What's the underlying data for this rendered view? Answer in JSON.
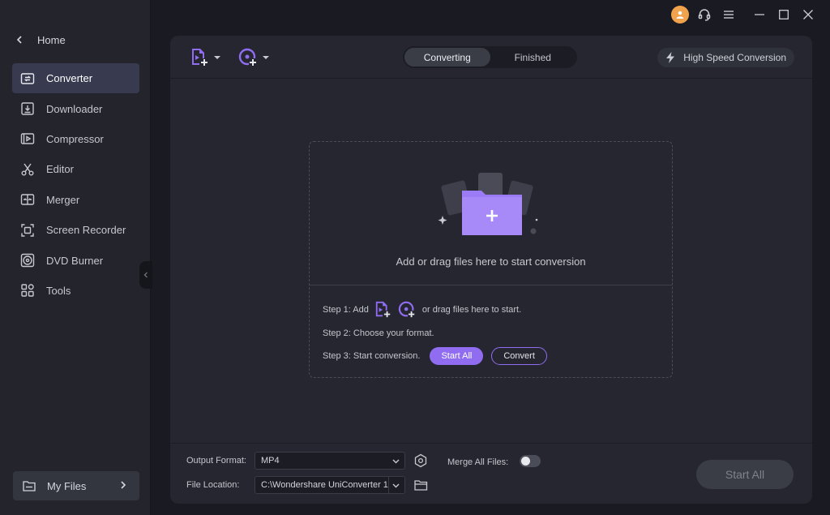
{
  "sidebar": {
    "home_label": "Home",
    "items": [
      {
        "label": "Converter",
        "icon": "converter-icon",
        "active": true
      },
      {
        "label": "Downloader",
        "icon": "downloader-icon"
      },
      {
        "label": "Compressor",
        "icon": "compressor-icon"
      },
      {
        "label": "Editor",
        "icon": "scissors-icon"
      },
      {
        "label": "Merger",
        "icon": "merger-icon"
      },
      {
        "label": "Screen Recorder",
        "icon": "screen-recorder-icon"
      },
      {
        "label": "DVD Burner",
        "icon": "dvd-icon"
      },
      {
        "label": "Tools",
        "icon": "grid-icon"
      }
    ],
    "my_files_label": "My Files"
  },
  "toolbar": {
    "tabs": [
      {
        "label": "Converting",
        "active": true
      },
      {
        "label": "Finished"
      }
    ],
    "high_speed_label": "High Speed Conversion"
  },
  "dropzone": {
    "text": "Add or drag files here to start conversion",
    "step1_prefix": "Step 1: Add",
    "step1_suffix": "or drag files here to start.",
    "step2": "Step 2: Choose your format.",
    "step3": "Step 3: Start conversion.",
    "start_all_label": "Start All",
    "convert_label": "Convert"
  },
  "bottom": {
    "output_format_label": "Output Format:",
    "output_format_value": "MP4",
    "merge_label": "Merge All Files:",
    "merge_on": false,
    "file_location_label": "File Location:",
    "file_location_value": "C:\\Wondershare UniConverter 1",
    "start_all_label": "Start All"
  },
  "colors": {
    "accent": "#8f6cf0",
    "avatar": "#f0a24c"
  }
}
